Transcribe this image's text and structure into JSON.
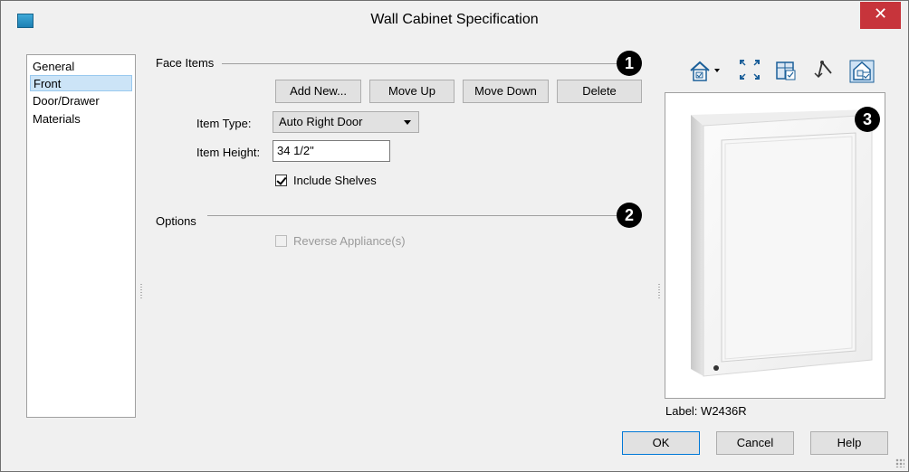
{
  "window": {
    "title": "Wall Cabinet Specification",
    "close_glyph": "✕",
    "accent_color": "#c7343b"
  },
  "nav": {
    "items": [
      {
        "label": "General",
        "selected": false
      },
      {
        "label": "Front",
        "selected": true
      },
      {
        "label": "Door/Drawer",
        "selected": false
      },
      {
        "label": "Materials",
        "selected": false
      }
    ]
  },
  "face_items": {
    "section_label": "Face Items",
    "callout": "1",
    "buttons": {
      "add_new": "Add New...",
      "move_up": "Move Up",
      "move_down": "Move Down",
      "delete": "Delete"
    },
    "item_type_label": "Item Type:",
    "item_type_value": "Auto Right Door",
    "item_height_label": "Item Height:",
    "item_height_value": "34 1/2\"",
    "include_shelves_label": "Include Shelves",
    "include_shelves_checked": true
  },
  "options": {
    "section_label": "Options",
    "callout": "2",
    "reverse_appliance_label": "Reverse Appliance(s)",
    "reverse_appliance_enabled": false
  },
  "preview": {
    "callout": "3",
    "label_prefix": "Label:",
    "label_value": "W2436R",
    "toolbar_icons": [
      "camera-view-icon",
      "fill-window-icon",
      "show-cabinet-icon",
      "orbit-icon",
      "show-room-icon"
    ]
  },
  "footer": {
    "ok": "OK",
    "cancel": "Cancel",
    "help": "Help"
  }
}
